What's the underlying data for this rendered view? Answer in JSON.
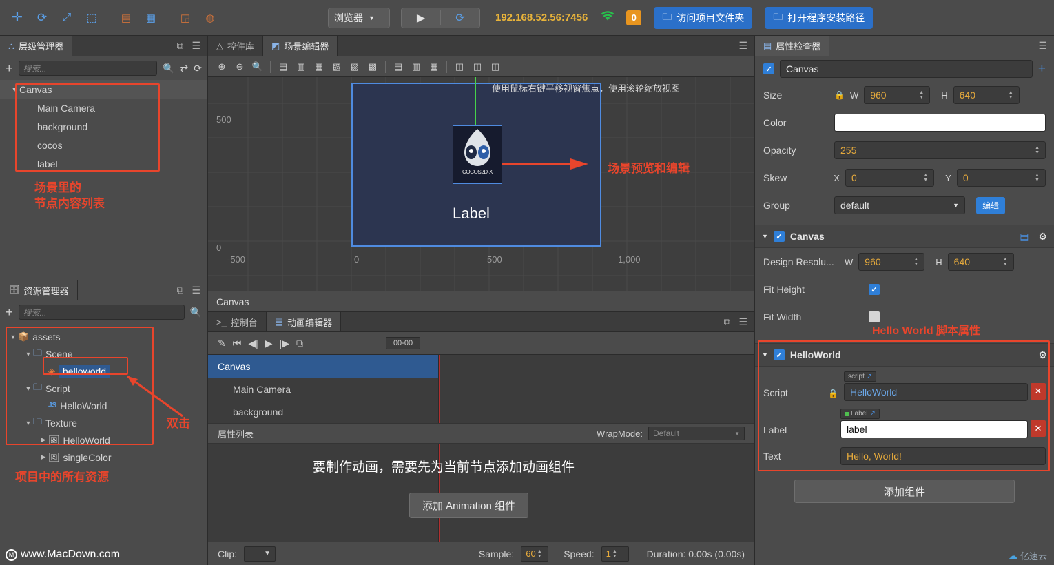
{
  "toolbar": {
    "icons": [
      "move-tool-icon",
      "rotate-tool-icon",
      "scale-tool-icon",
      "rect-tool-icon",
      "align-icon",
      "grid-icon",
      "device-icon",
      "color-icon"
    ],
    "browser_select": "浏览器",
    "play_label": "play-icon",
    "refresh_label": "refresh-icon",
    "ip": "192.168.52.56:7456",
    "wifi": "wifi-icon",
    "badge": "0",
    "open_project_folder": "访问项目文件夹",
    "open_install_path": "打开程序安装路径"
  },
  "hierarchy": {
    "tab": "层级管理器",
    "search_placeholder": "搜索...",
    "nodes": [
      {
        "label": "Canvas",
        "depth": 0,
        "selected": true,
        "expand": "▼"
      },
      {
        "label": "Main Camera",
        "depth": 1,
        "selected": false,
        "expand": ""
      },
      {
        "label": "background",
        "depth": 1,
        "selected": false,
        "expand": ""
      },
      {
        "label": "cocos",
        "depth": 1,
        "selected": false,
        "expand": ""
      },
      {
        "label": "label",
        "depth": 1,
        "selected": false,
        "expand": ""
      }
    ],
    "annotation": "场景里的\n节点内容列表"
  },
  "assets": {
    "tab": "资源管理器",
    "search_placeholder": "搜索...",
    "nodes": [
      {
        "label": "assets",
        "depth": 0,
        "expand": "▼",
        "icon": "package-icon"
      },
      {
        "label": "Scene",
        "depth": 1,
        "expand": "▼",
        "icon": "folder-icon"
      },
      {
        "label": "helloworld",
        "depth": 2,
        "expand": "",
        "icon": "scene-icon",
        "highlight": true
      },
      {
        "label": "Script",
        "depth": 1,
        "expand": "▼",
        "icon": "folder-icon"
      },
      {
        "label": "HelloWorld",
        "depth": 2,
        "expand": "",
        "icon": "js-icon"
      },
      {
        "label": "Texture",
        "depth": 1,
        "expand": "▼",
        "icon": "folder-icon"
      },
      {
        "label": "HelloWorld",
        "depth": 2,
        "expand": "▶",
        "icon": "image-icon"
      },
      {
        "label": "singleColor",
        "depth": 2,
        "expand": "▶",
        "icon": "image-icon"
      }
    ],
    "annotation_dblclick": "双击",
    "annotation_all": "项目中的所有资源"
  },
  "scene": {
    "tabs": [
      {
        "label": "控件库",
        "icon": "triangle-icon",
        "active": false
      },
      {
        "label": "场景编辑器",
        "icon": "scene-icon",
        "active": true
      }
    ],
    "hint": "使用鼠标右键平移视窗焦点，使用滚轮缩放视图",
    "axis": {
      "y_500": "500",
      "y_0": "0",
      "x_m500": "-500",
      "x_0": "0",
      "x_500": "500",
      "x_1000": "1,000"
    },
    "label_node_text": "Label",
    "sprite_caption": "COCOS2D-X",
    "footer": "Canvas",
    "annotation": "场景预览和编辑"
  },
  "animation": {
    "tabs": [
      {
        "label": "控制台",
        "icon": "console-icon",
        "active": false
      },
      {
        "label": "动画编辑器",
        "icon": "film-icon",
        "active": true
      }
    ],
    "timecode": "00-00",
    "rows": [
      {
        "label": "Canvas",
        "selected": true
      },
      {
        "label": "Main Camera",
        "selected": false
      },
      {
        "label": "background",
        "selected": false
      }
    ],
    "prop_list_label": "属性列表",
    "wrapmode_label": "WrapMode:",
    "wrapmode_value": "Default",
    "message": "要制作动画，需要先为当前节点添加动画组件",
    "add_button": "添加 Animation 组件",
    "footer": {
      "clip_label": "Clip:",
      "clip_value": "",
      "sample_label": "Sample:",
      "sample_value": "60",
      "speed_label": "Speed:",
      "speed_value": "1",
      "duration": "Duration: 0.00s (0.00s)"
    }
  },
  "inspector": {
    "tab": "属性检查器",
    "node_name": "Canvas",
    "node_enabled": true,
    "add_icon": "+",
    "props": [
      {
        "label": "Size",
        "type": "wh",
        "lock": true,
        "w_label": "W",
        "w": "960",
        "h_label": "H",
        "h": "640"
      },
      {
        "label": "Color",
        "type": "color",
        "value": "#ffffff"
      },
      {
        "label": "Opacity",
        "type": "num",
        "value": "255"
      },
      {
        "label": "Skew",
        "type": "xy",
        "x_label": "X",
        "x": "0",
        "y_label": "Y",
        "y": "0"
      },
      {
        "label": "Group",
        "type": "select",
        "value": "default",
        "button": "编辑"
      }
    ],
    "canvas_component": {
      "title": "Canvas",
      "enabled": true,
      "design_label": "Design Resolu...",
      "w_label": "W",
      "w": "960",
      "h_label": "H",
      "h": "640",
      "fit_height_label": "Fit Height",
      "fit_height": true,
      "fit_width_label": "Fit Width",
      "fit_width": false
    },
    "script_annotation": "Hello World 脚本属性",
    "helloworld_component": {
      "title": "HelloWorld",
      "enabled": true,
      "script_label": "Script",
      "script_tag": "script",
      "script_value": "HelloWorld",
      "label_label": "Label",
      "label_tag": "Label",
      "label_value": "label",
      "text_label": "Text",
      "text_value": "Hello, World!"
    },
    "add_component": "添加组件"
  },
  "watermark": {
    "text": "www.MacDown.com",
    "corner": "亿速云"
  }
}
